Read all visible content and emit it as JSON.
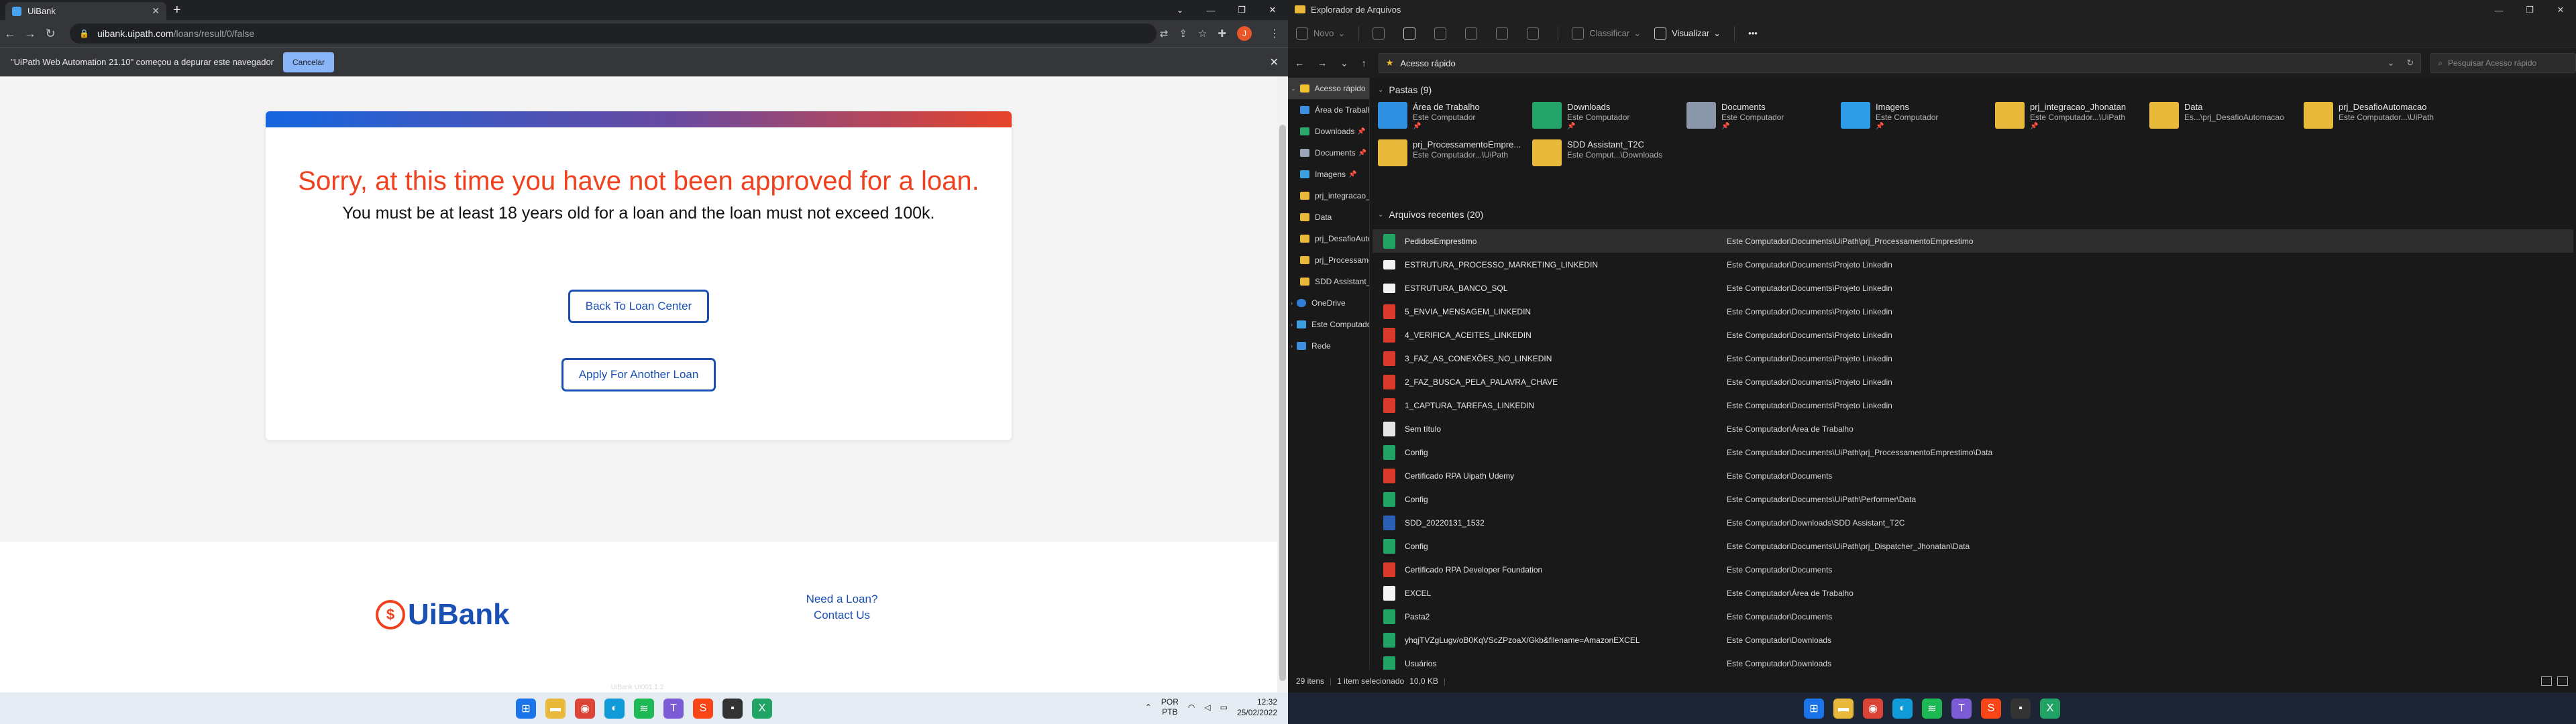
{
  "browser": {
    "tab_title": "UiBank",
    "url_host": "uibank.uipath.com",
    "url_path": "/loans/result/0/false",
    "profile_initial": "J",
    "infobar_text": "\"UiPath Web Automation 21.10\" começou a depurar este navegador",
    "infobar_cancel": "Cancelar"
  },
  "page": {
    "title": "Sorry, at this time you have not been approved for a loan.",
    "message": "You must be at least 18 years old for a loan and the loan must not exceed 100k.",
    "btn_back": "Back To Loan Center",
    "btn_apply": "Apply For Another Loan",
    "logo_symbol": "$",
    "logo_text": "UiBank",
    "link_need": "Need a Loan?",
    "link_contact": "Contact Us",
    "footer_faded": "UiBank UI001.1.2"
  },
  "taskbar": {
    "lang_1": "POR",
    "lang_2": "PTB",
    "time": "12:32",
    "date": "25/02/2022"
  },
  "explorer": {
    "window_title": "Explorador de Arquivos",
    "cmd_new": "Novo",
    "cmd_sort": "Classificar",
    "cmd_view": "Visualizar",
    "address": "Acesso rápido",
    "search_placeholder": "Pesquisar Acesso rápido",
    "nav": [
      {
        "label": "Acesso rápido",
        "pinned": false
      },
      {
        "label": "Área de Trabalh",
        "pinned": true
      },
      {
        "label": "Downloads",
        "pinned": true
      },
      {
        "label": "Documents",
        "pinned": true
      },
      {
        "label": "Imagens",
        "pinned": true
      },
      {
        "label": "prj_integracao_",
        "pinned": true
      },
      {
        "label": "Data",
        "pinned": false
      },
      {
        "label": "prj_DesafioAutom",
        "pinned": false
      },
      {
        "label": "prj_Processament",
        "pinned": false
      },
      {
        "label": "SDD Assistant_T2C",
        "pinned": false
      },
      {
        "label": "OneDrive",
        "pinned": false
      },
      {
        "label": "Este Computador",
        "pinned": false
      },
      {
        "label": "Rede",
        "pinned": false
      }
    ],
    "folders_header": "Pastas (9)",
    "folders": [
      {
        "name": "Área de Trabalho",
        "sub": "Este Computador"
      },
      {
        "name": "Downloads",
        "sub": "Este Computador"
      },
      {
        "name": "Documents",
        "sub": "Este Computador"
      },
      {
        "name": "Imagens",
        "sub": "Este Computador"
      },
      {
        "name": "prj_integracao_Jhonatan",
        "sub": "Este Computador...\\UiPath"
      },
      {
        "name": "Data",
        "sub": "Es...\\prj_DesafioAutomacao"
      },
      {
        "name": "prj_DesafioAutomacao",
        "sub": "Este Computador...\\UiPath"
      },
      {
        "name": "prj_ProcessamentoEmpre...",
        "sub": "Este Computador...\\UiPath"
      },
      {
        "name": "SDD Assistant_T2C",
        "sub": "Este Comput...\\Downloads"
      }
    ],
    "recent_header": "Arquivos recentes (20)",
    "recent": [
      {
        "name": "PedidosEmprestimo",
        "loc": "Este Computador\\Documents\\UiPath\\prj_ProcessamentoEmprestimo"
      },
      {
        "name": "ESTRUTURA_PROCESSO_MARKETING_LINKEDIN",
        "loc": "Este Computador\\Documents\\Projeto Linkedin"
      },
      {
        "name": "ESTRUTURA_BANCO_SQL",
        "loc": "Este Computador\\Documents\\Projeto Linkedin"
      },
      {
        "name": "5_ENVIA_MENSAGEM_LINKEDIN",
        "loc": "Este Computador\\Documents\\Projeto Linkedin"
      },
      {
        "name": "4_VERIFICA_ACEITES_LINKEDIN",
        "loc": "Este Computador\\Documents\\Projeto Linkedin"
      },
      {
        "name": "3_FAZ_AS_CONEXÕES_NO_LINKEDIN",
        "loc": "Este Computador\\Documents\\Projeto Linkedin"
      },
      {
        "name": "2_FAZ_BUSCA_PELA_PALAVRA_CHAVE",
        "loc": "Este Computador\\Documents\\Projeto Linkedin"
      },
      {
        "name": "1_CAPTURA_TAREFAS_LINKEDIN",
        "loc": "Este Computador\\Documents\\Projeto Linkedin"
      },
      {
        "name": "Sem título",
        "loc": "Este Computador\\Área de Trabalho"
      },
      {
        "name": "Config",
        "loc": "Este Computador\\Documents\\UiPath\\prj_ProcessamentoEmprestimo\\Data"
      },
      {
        "name": "Certificado RPA Uipath Udemy",
        "loc": "Este Computador\\Documents"
      },
      {
        "name": "Config",
        "loc": "Este Computador\\Documents\\UiPath\\Performer\\Data"
      },
      {
        "name": "SDD_20220131_1532",
        "loc": "Este Computador\\Downloads\\SDD Assistant_T2C"
      },
      {
        "name": "Config",
        "loc": "Este Computador\\Documents\\UiPath\\prj_Dispatcher_Jhonatan\\Data"
      },
      {
        "name": "Certificado RPA Developer Foundation",
        "loc": "Este Computador\\Documents"
      },
      {
        "name": "EXCEL",
        "loc": "Este Computador\\Área de Trabalho"
      },
      {
        "name": "Pasta2",
        "loc": "Este Computador\\Documents"
      },
      {
        "name": "yhqjTVZgLugv/oB0KqVScZPzoaX/Gkb&filename=AmazonEXCEL",
        "loc": "Este Computador\\Downloads"
      },
      {
        "name": "Usuários",
        "loc": "Este Computador\\Downloads"
      }
    ],
    "status_items": "29 itens",
    "status_selected": "1 item selecionado",
    "status_size": "10,0 KB"
  }
}
